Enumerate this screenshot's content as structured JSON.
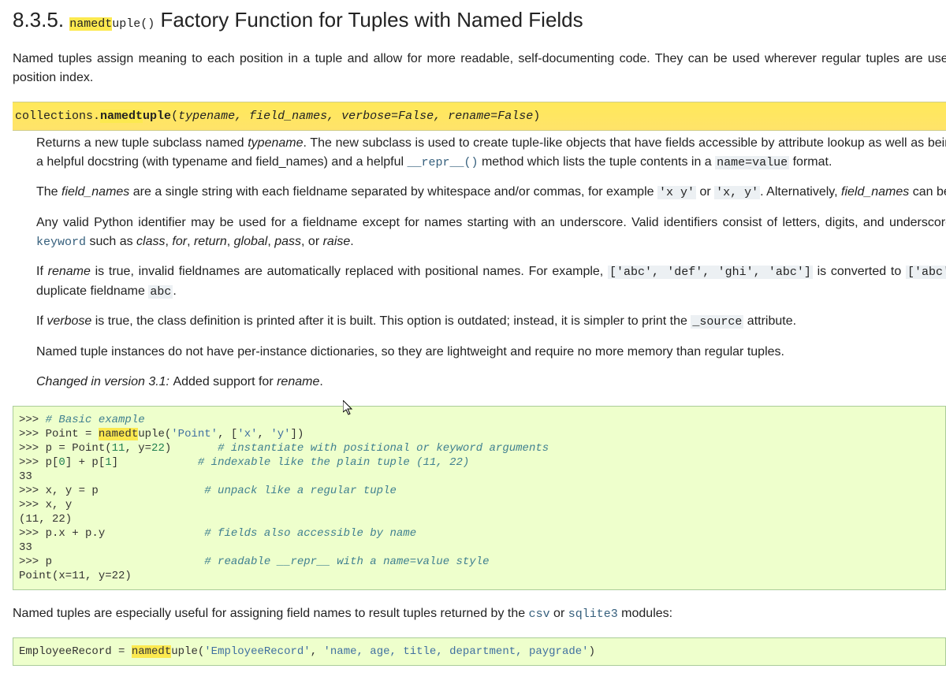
{
  "heading": {
    "number": "8.3.5. ",
    "code_hl": "namedt",
    "code_rest": "uple()",
    "title_rest": " Factory Function for Tuples with Named Fields"
  },
  "intro": "Named tuples assign meaning to each position in a tuple and allow for more readable, self-documenting code. They can be used wherever regular tuples are used, position index.",
  "sig": {
    "module": "collections.",
    "name_hl": "namedt",
    "name_rest": "uple",
    "open": "(",
    "p1": "typename",
    "c": ", ",
    "p2": "field_names",
    "p3": "verbose=False",
    "p4": "rename=False",
    "close": ")"
  },
  "para1": {
    "a": "Returns a new tuple subclass named ",
    "b": "typename",
    "c": ". The new subclass is used to create tuple-like objects that have fields accessible by attribute lookup as well as being a helpful docstring (with typename and field_names) and a helpful ",
    "link": "__repr__()",
    "d": " method which lists the tuple contents in a ",
    "lit": "name=value",
    "e": " format."
  },
  "para2": {
    "a": "The ",
    "b": "field_names",
    "c": " are a single string with each fieldname separated by whitespace and/or commas, for example ",
    "lit1": "'x y'",
    "d": " or ",
    "lit2": "'x, y'",
    "e": ". Alternatively, ",
    "f": "field_names",
    "g": " can be "
  },
  "para3": {
    "a": "Any valid Python identifier may be used for a fieldname except for names starting with an underscore. Valid identifiers consist of letters, digits, and underscores ",
    "link": "keyword",
    "b": " such as ",
    "i1": "class",
    "c1": ", ",
    "i2": "for",
    "c2": ", ",
    "i3": "return",
    "c3": ", ",
    "i4": "global",
    "c4": ", ",
    "i5": "pass",
    "c5": ", or ",
    "i6": "raise",
    "end": "."
  },
  "para4": {
    "a": "If ",
    "b": "rename",
    "c": " is true, invalid fieldnames are automatically replaced with positional names. For example, ",
    "lit1": "['abc', 'def', 'ghi', 'abc']",
    "d": " is converted to ",
    "lit2": "['abc', ",
    "e": " duplicate fieldname ",
    "lit3": "abc",
    "f": "."
  },
  "para5": {
    "a": "If ",
    "b": "verbose",
    "c": " is true, the class definition is printed after it is built. This option is outdated; instead, it is simpler to print the ",
    "lit": "_source",
    "d": " attribute."
  },
  "para6": "Named tuple instances do not have per-instance dictionaries, so they are lightweight and require no more memory than regular tuples.",
  "changed": {
    "label": "Changed in version 3.1: ",
    "text": "Added support for ",
    "em": "rename",
    "end": "."
  },
  "code_example": {
    "prompt": ">>> ",
    "c1": "# Basic example",
    "l2a": "Point = ",
    "l2hl": "namedt",
    "l2b": "uple(",
    "l2s1": "'Point'",
    "l2c": ", [",
    "l2s2": "'x'",
    "l2d": ", ",
    "l2s3": "'y'",
    "l2e": "])",
    "l3a": "p = Point(",
    "l3n1": "11",
    "l3b": ", y=",
    "l3n2": "22",
    "l3c": ")       ",
    "c3": "# instantiate with positional or keyword arguments",
    "l4a": "p[",
    "l4n1": "0",
    "l4b": "] + p[",
    "l4n2": "1",
    "l4c": "]            ",
    "c4": "# indexable like the plain tuple (11, 22)",
    "out4": "33",
    "l5": "x, y = p                ",
    "c5": "# unpack like a regular tuple",
    "l6": "x, y",
    "out6": "(11, 22)",
    "l7": "p.x + p.y               ",
    "c7": "# fields also accessible by name",
    "out7": "33",
    "l8": "p                       ",
    "c8": "# readable __repr__ with a name=value style",
    "out8": "Point(x=11, y=22)"
  },
  "para7": {
    "a": "Named tuples are especially useful for assigning field names to result tuples returned by the ",
    "link1": "csv",
    "b": " or ",
    "link2": "sqlite3",
    "c": " modules:"
  },
  "code_example2": {
    "l1a": "EmployeeRecord = ",
    "l1hl": "namedt",
    "l1b": "uple(",
    "l1s1": "'EmployeeRecord'",
    "l1c": ", ",
    "l1s2": "'name, age, title, department, paygrade'",
    "l1d": ")"
  }
}
